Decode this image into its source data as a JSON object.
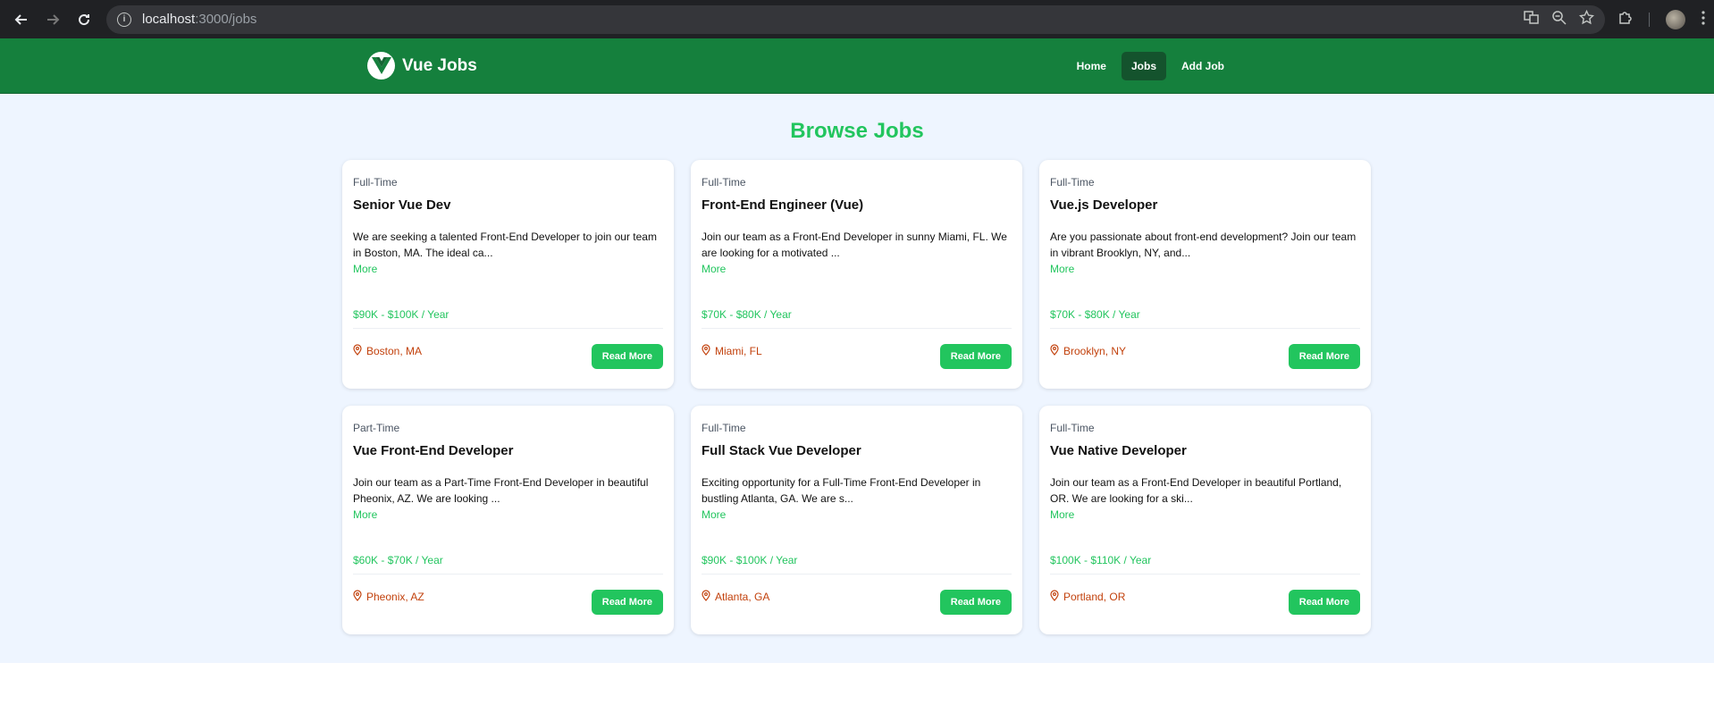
{
  "browser": {
    "url_host": "localhost",
    "url_path": ":3000/jobs"
  },
  "navbar": {
    "brand": "Vue Jobs",
    "links": [
      "Home",
      "Jobs",
      "Add Job"
    ],
    "active_link": "Jobs"
  },
  "heading": "Browse Jobs",
  "jobs": [
    {
      "type": "Full-Time",
      "title": "Senior Vue Dev",
      "description": "We are seeking a talented Front-End Developer to join our team in Boston, MA. The ideal ca...",
      "more_label": "More",
      "salary": "$90K - $100K / Year",
      "location": "Boston, MA",
      "button": "Read More"
    },
    {
      "type": "Full-Time",
      "title": "Front-End Engineer (Vue)",
      "description": "Join our team as a Front-End Developer in sunny Miami, FL. We are looking for a motivated ...",
      "more_label": "More",
      "salary": "$70K - $80K / Year",
      "location": "Miami, FL",
      "button": "Read More"
    },
    {
      "type": "Full-Time",
      "title": "Vue.js Developer",
      "description": "Are you passionate about front-end development? Join our team in vibrant Brooklyn, NY, and...",
      "more_label": "More",
      "salary": "$70K - $80K / Year",
      "location": "Brooklyn, NY",
      "button": "Read More"
    },
    {
      "type": "Part-Time",
      "title": "Vue Front-End Developer",
      "description": "Join our team as a Part-Time Front-End Developer in beautiful Pheonix, AZ. We are looking ...",
      "more_label": "More",
      "salary": "$60K - $70K / Year",
      "location": "Pheonix, AZ",
      "button": "Read More"
    },
    {
      "type": "Full-Time",
      "title": "Full Stack Vue Developer",
      "description": "Exciting opportunity for a Full-Time Front-End Developer in bustling Atlanta, GA. We are s...",
      "more_label": "More",
      "salary": "$90K - $100K / Year",
      "location": "Atlanta, GA",
      "button": "Read More"
    },
    {
      "type": "Full-Time",
      "title": "Vue Native Developer",
      "description": "Join our team as a Front-End Developer in beautiful Portland, OR. We are looking for a ski...",
      "more_label": "More",
      "salary": "$100K - $110K / Year",
      "location": "Portland, OR",
      "button": "Read More"
    }
  ],
  "colors": {
    "navbar_bg": "#15803d",
    "accent": "#22c55e",
    "location": "#c2410c",
    "page_bg": "#eef5ff"
  }
}
